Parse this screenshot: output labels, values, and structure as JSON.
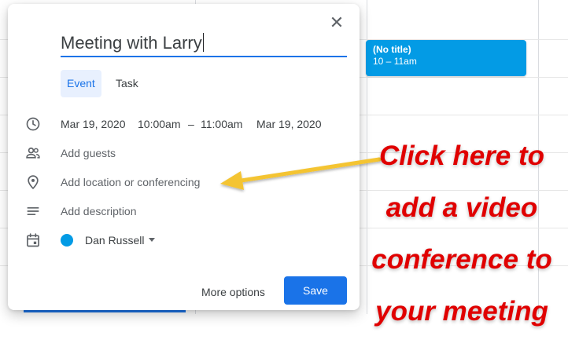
{
  "calendar_event": {
    "title": "(No title)",
    "time": "10 – 11am",
    "color": "#039be5"
  },
  "dialog": {
    "title_value": "Meeting with Larry",
    "close_icon": "close-icon",
    "tabs": [
      {
        "label": "Event",
        "active": true
      },
      {
        "label": "Task",
        "active": false
      }
    ],
    "date_start": "Mar 19, 2020",
    "time_start": "10:00am",
    "time_sep": "–",
    "time_end": "11:00am",
    "date_end": "Mar 19, 2020",
    "add_guests": "Add guests",
    "add_location": "Add location or conferencing",
    "add_description": "Add description",
    "calendar_name": "Dan Russell",
    "calendar_color": "#039be5",
    "more_options": "More options",
    "save": "Save",
    "accent_color": "#1a73e8"
  },
  "annotation": {
    "lines": [
      "Click here to",
      "add a video",
      "conference to",
      "your meeting"
    ],
    "color": "#e00000",
    "arrow_color": "#f4c430"
  }
}
